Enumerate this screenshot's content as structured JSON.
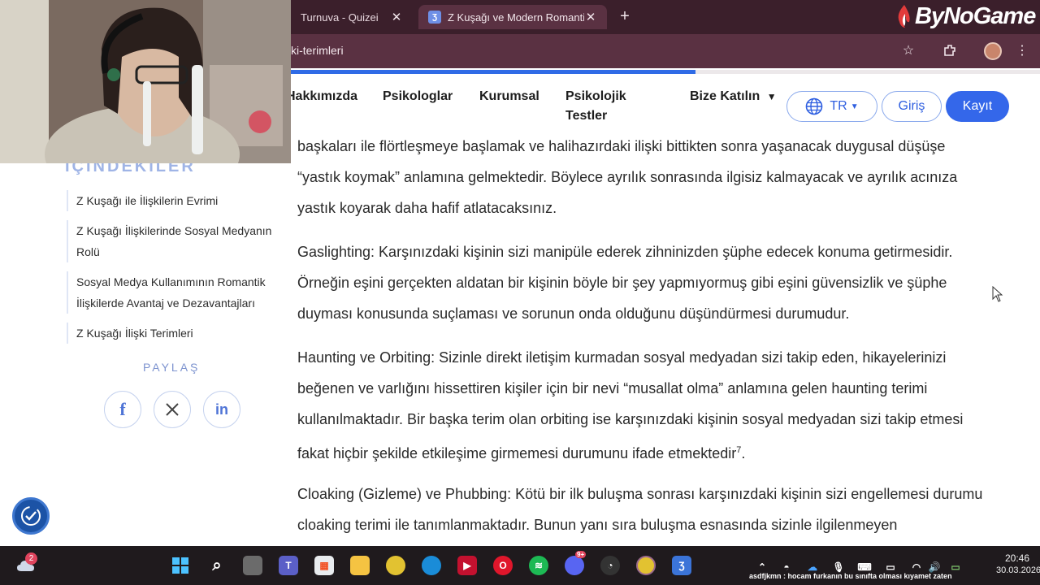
{
  "browser": {
    "tabs": [
      {
        "title": "Turnuva - Quizei",
        "active": false
      },
      {
        "title": "Z Kuşağı ve Modern Romantik İl",
        "active": true
      }
    ],
    "new_tab_symbol": "+",
    "brand": "ByNoGame",
    "url": "ki-terimleri",
    "reading_progress": 0.54
  },
  "site_nav": {
    "links": [
      "Hakkımızda",
      "Psikologlar",
      "Kurumsal",
      "Psikolojik Testler",
      "Bize Katılın"
    ],
    "language": "TR",
    "login": "Giriş",
    "register": "Kayıt"
  },
  "sidebar": {
    "toc_title": "İÇİNDEKİLER",
    "toc_items": [
      "Z Kuşağı ile İlişkilerin Evrimi",
      "Z Kuşağı İlişkilerinde Sosyal Medyanın Rolü",
      "Sosyal Medya Kullanımının Romantik İlişkilerde Avantaj ve Dezavantajları",
      "Z Kuşağı İlişki Terimleri"
    ],
    "share_title": "PAYLAŞ",
    "share_buttons": [
      "facebook-icon",
      "x-icon",
      "linkedin-icon"
    ]
  },
  "article": {
    "paragraphs": [
      "başkaları ile flörtleşmeye başlamak ve halihazırdaki ilişki bittikten sonra yaşanacak duygusal düşüşe “yastık koymak” anlamına gelmektedir. Böylece ayrılık sonrasında ilgisiz kalmayacak ve ayrılık acınıza yastık koyarak daha hafif atlatacaksınız.",
      "Gaslighting: Karşınızdaki kişinin sizi manipüle ederek zihninizden şüphe edecek konuma getirmesidir. Örneğin eşini gerçekten aldatan bir kişinin böyle bir şey yapmıyormuş gibi eşini güvensizlik ve şüphe duyması konusunda suçlaması ve sorunun onda olduğunu düşündürmesi durumudur.",
      "Haunting ve Orbiting: Sizinle direkt iletişim kurmadan sosyal medyadan sizi takip eden, hikayelerinizi beğenen ve varlığını hissettiren kişiler için bir nevi “musallat olma” anlamına gelen haunting terimi kullanılmaktadır. Bir başka terim olan orbiting ise karşınızdaki kişinin sosyal medyadan sizi takip etmesi fakat hiçbir şekilde etkileşime girmemesi durumunu ifade etmektedir",
      "Cloaking (Gizleme) ve Phubbing: Kötü bir ilk buluşma sonrası karşınızdaki kişinin sizi engellemesi durumu cloaking terimi ile tanımlanmaktadır. Bunun yanı sıra buluşma esnasında sizinle ilgilenmeyen"
    ],
    "footnote": "7",
    "footnote_suffix": "."
  },
  "taskbar": {
    "weather_badge": "2",
    "discord_badge": "9+",
    "time": "20:46",
    "date": "30.03.2026",
    "ticker": "asdfjkmn : hocam furkanın bu sınıfta olması kıyamet zaten"
  },
  "colors": {
    "chrome_dark": "#3b1f2b",
    "chrome_toolbar": "#5a3142",
    "accent_blue": "#3467ea",
    "progress": "#2f6be6"
  }
}
